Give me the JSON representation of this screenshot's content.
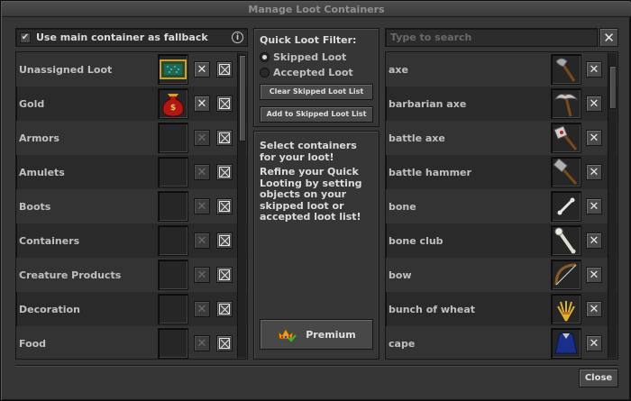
{
  "window": {
    "title": "Manage Loot Containers"
  },
  "fallback": {
    "checked": true,
    "check_glyph": "✔",
    "label": "Use main container as fallback",
    "info_glyph": "i"
  },
  "search": {
    "placeholder": "Type to search",
    "clear_glyph": "✕"
  },
  "categories": [
    {
      "label": "Unassigned Loot",
      "icon": "green-backpack-icon",
      "buttons_enabled": true
    },
    {
      "label": "Gold",
      "icon": "red-money-bag-icon",
      "buttons_enabled": true
    },
    {
      "label": "Armors",
      "icon": "empty-slot",
      "buttons_enabled": false
    },
    {
      "label": "Amulets",
      "icon": "empty-slot",
      "buttons_enabled": false
    },
    {
      "label": "Boots",
      "icon": "empty-slot",
      "buttons_enabled": false
    },
    {
      "label": "Containers",
      "icon": "empty-slot",
      "buttons_enabled": false
    },
    {
      "label": "Creature Products",
      "icon": "empty-slot",
      "buttons_enabled": false
    },
    {
      "label": "Decoration",
      "icon": "empty-slot",
      "buttons_enabled": false
    },
    {
      "label": "Food",
      "icon": "empty-slot",
      "buttons_enabled": false
    }
  ],
  "quick_loot_filter": {
    "title": "Quick Loot Filter:",
    "options": [
      {
        "label": "Skipped Loot",
        "selected": true
      },
      {
        "label": "Accepted Loot",
        "selected": false
      }
    ],
    "clear_button": "Clear Skipped Loot List",
    "add_button": "Add to Skipped Loot List"
  },
  "info": {
    "line1": "Select containers for your loot!",
    "line2": "Refine your Quick Looting by setting objects on your skipped loot or accepted loot list!",
    "premium_label": "Premium"
  },
  "items": [
    {
      "label": "axe",
      "icon": "axe-icon"
    },
    {
      "label": "barbarian axe",
      "icon": "barbarian-axe-icon"
    },
    {
      "label": "battle axe",
      "icon": "battle-axe-icon"
    },
    {
      "label": "battle hammer",
      "icon": "battle-hammer-icon"
    },
    {
      "label": "bone",
      "icon": "bone-icon"
    },
    {
      "label": "bone club",
      "icon": "bone-club-icon"
    },
    {
      "label": "bow",
      "icon": "bow-icon"
    },
    {
      "label": "bunch of wheat",
      "icon": "wheat-icon"
    },
    {
      "label": "cape",
      "icon": "cape-icon"
    }
  ],
  "footer": {
    "close_label": "Close"
  }
}
